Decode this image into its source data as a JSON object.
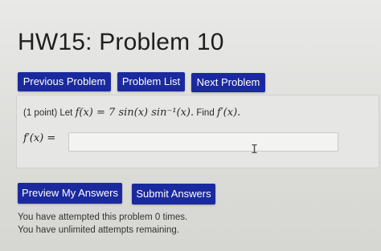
{
  "header": {
    "title": "HW15: Problem 10"
  },
  "nav": {
    "previous_label": "Previous Problem",
    "list_label": "Problem List",
    "next_label": "Next Problem"
  },
  "problem": {
    "points": "(1 point)",
    "prompt_prefix": "Let",
    "function": "f(x) = 7 sin(x) sin⁻¹(x).",
    "find_text": "Find",
    "find_target": "f′(x).",
    "answer_label": "f′(x) =",
    "answer_value": ""
  },
  "actions": {
    "preview_label": "Preview My Answers",
    "submit_label": "Submit Answers"
  },
  "status": {
    "attempts_text": "You have attempted this problem 0 times.",
    "remaining_text": "You have unlimited attempts remaining."
  },
  "colors": {
    "button_bg": "#1a2a9e",
    "button_text": "#ffffff"
  },
  "icons": {
    "cursor": "text-cursor-icon"
  }
}
